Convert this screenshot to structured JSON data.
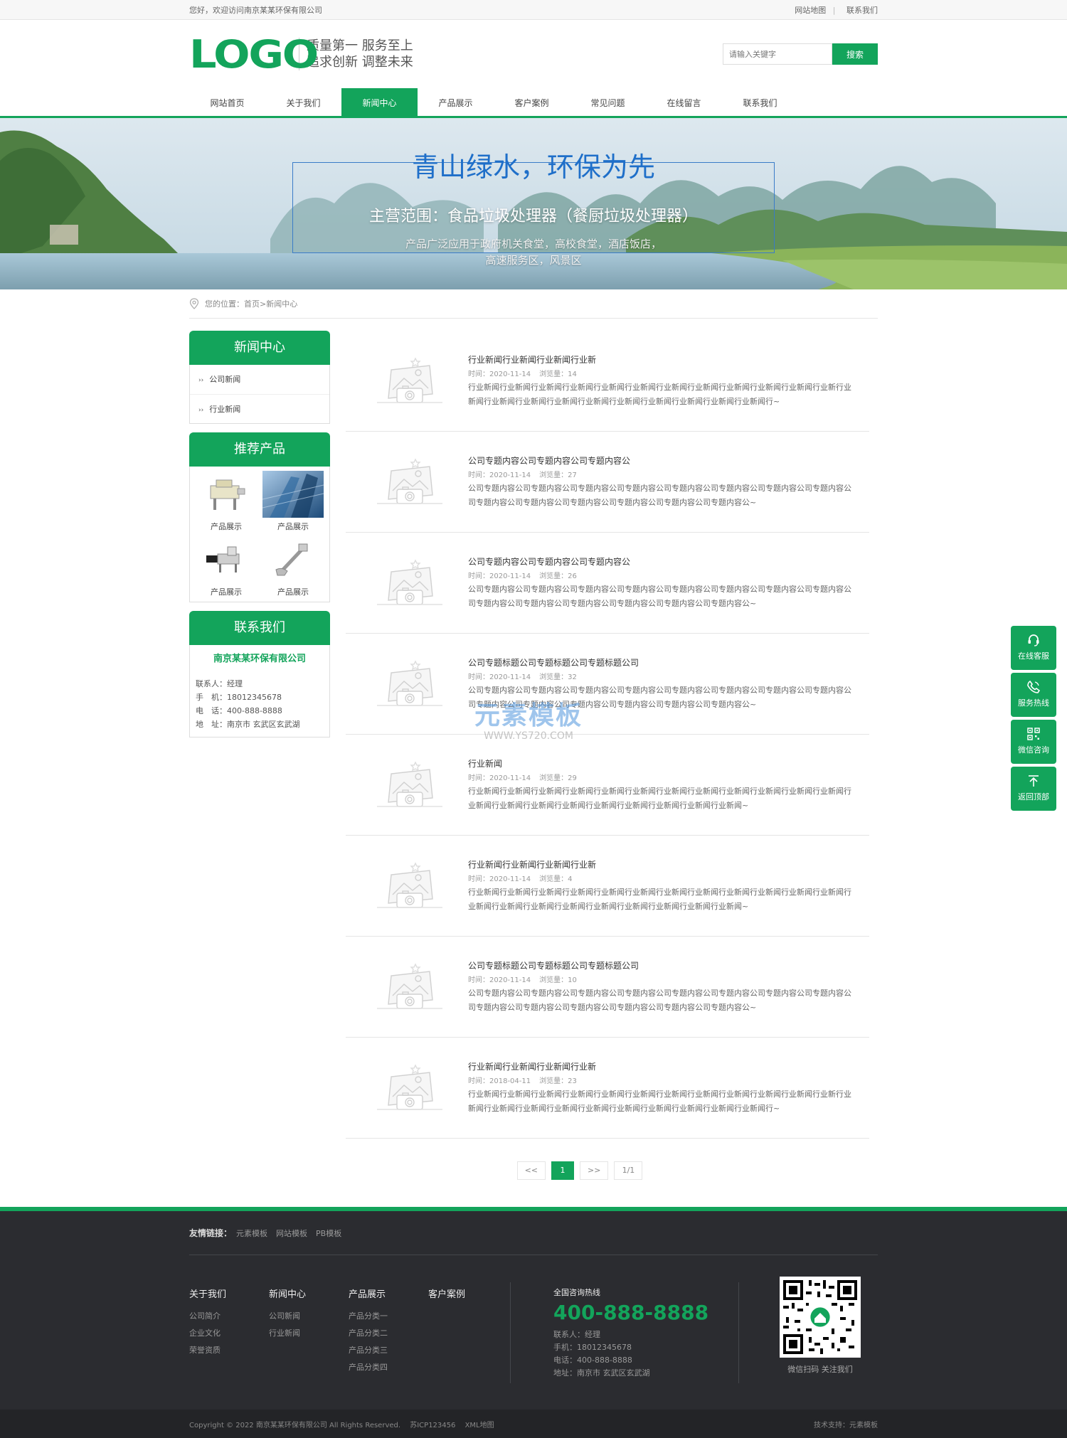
{
  "topbar": {
    "welcome": "您好，欢迎访问南京某某环保有限公司",
    "sitemap": "网站地图",
    "sep": "|",
    "contact": "联系我们"
  },
  "header": {
    "logo": "LOGO",
    "slogan_line1": "质量第一  服务至上",
    "slogan_line2": "追求创新  调整未来",
    "search_placeholder": "请输入关键字",
    "search_button": "搜索"
  },
  "nav": [
    {
      "label": "网站首页"
    },
    {
      "label": "关于我们"
    },
    {
      "label": "新闻中心"
    },
    {
      "label": "产品展示"
    },
    {
      "label": "客户案例"
    },
    {
      "label": "常见问题"
    },
    {
      "label": "在线留言"
    },
    {
      "label": "联系我们"
    }
  ],
  "banner": {
    "title": "青山绿水，环保为先",
    "subtitle": "主营范围：食品垃圾处理器（餐厨垃圾处理器）",
    "desc_line1": "产品广泛应用于政府机关食堂，高校食堂，酒店饭店，",
    "desc_line2": "高速服务区，风景区"
  },
  "breadcrumb": "您的位置：首页>新闻中心",
  "sidebar": {
    "news_title": "新闻中心",
    "categories": [
      {
        "arrow": "››",
        "label": "公司新闻"
      },
      {
        "arrow": "››",
        "label": "行业新闻"
      }
    ],
    "products_title": "推荐产品",
    "products": [
      {
        "label": "产品展示"
      },
      {
        "label": "产品展示"
      },
      {
        "label": "产品展示"
      },
      {
        "label": "产品展示"
      }
    ],
    "contact_title": "联系我们",
    "company": "南京某某环保有限公司",
    "contact_lines": [
      "联系人：经理",
      "手　机：18012345678",
      "电　话：400-888-8888",
      "地　址：南京市 玄武区玄武湖"
    ]
  },
  "news": [
    {
      "title": "行业新闻行业新闻行业新闻行业新",
      "time": "时间：2020-11-14",
      "views": "浏览量：14",
      "desc": "行业新闻行业新闻行业新闻行业新闻行业新闻行业新闻行业新闻行业新闻行业新闻行业新闻行业新闻行业新行业新闻行业新闻行业新闻行业新闻行业新闻行业新闻行业新闻行业新闻行业新闻行业新闻行~"
    },
    {
      "title": "公司专题内容公司专题内容公司专题内容公",
      "time": "时间：2020-11-14",
      "views": "浏览量：27",
      "desc": "公司专题内容公司专题内容公司专题内容公司专题内容公司专题内容公司专题内容公司专题内容公司专题内容公司专题内容公司专题内容公司专题内容公司专题内容公司专题内容公司专题内容公~"
    },
    {
      "title": "公司专题内容公司专题内容公司专题内容公",
      "time": "时间：2020-11-14",
      "views": "浏览量：26",
      "desc": "公司专题内容公司专题内容公司专题内容公司专题内容公司专题内容公司专题内容公司专题内容公司专题内容公司专题内容公司专题内容公司专题内容公司专题内容公司专题内容公司专题内容公~"
    },
    {
      "title": "公司专题标题公司专题标题公司专题标题公司",
      "time": "时间：2020-11-14",
      "views": "浏览量：32",
      "desc": "公司专题内容公司专题内容公司专题内容公司专题内容公司专题内容公司专题内容公司专题内容公司专题内容公司专题内容公司专题内容公司专题内容公司专题内容公司专题内容公司专题内容公~"
    },
    {
      "title": "行业新闻",
      "time": "时间：2020-11-14",
      "views": "浏览量：29",
      "desc": "行业新闻行业新闻行业新闻行业新闻行业新闻行业新闻行业新闻行业新闻行业新闻行业新闻行业新闻行业新闻行业新闻行业新闻行业新闻行业新闻行业新闻行业新闻行业新闻行业新闻行业新闻~"
    },
    {
      "title": "行业新闻行业新闻行业新闻行业新",
      "time": "时间：2020-11-14",
      "views": "浏览量：4",
      "desc": "行业新闻行业新闻行业新闻行业新闻行业新闻行业新闻行业新闻行业新闻行业新闻行业新闻行业新闻行业新闻行业新闻行业新闻行业新闻行业新闻行业新闻行业新闻行业新闻行业新闻行业新闻~"
    },
    {
      "title": "公司专题标题公司专题标题公司专题标题公司",
      "time": "时间：2020-11-14",
      "views": "浏览量：10",
      "desc": "公司专题内容公司专题内容公司专题内容公司专题内容公司专题内容公司专题内容公司专题内容公司专题内容公司专题内容公司专题内容公司专题内容公司专题内容公司专题内容公司专题内容公~"
    },
    {
      "title": "行业新闻行业新闻行业新闻行业新",
      "time": "时间：2018-04-11",
      "views": "浏览量：23",
      "desc": "行业新闻行业新闻行业新闻行业新闻行业新闻行业新闻行业新闻行业新闻行业新闻行业新闻行业新闻行业新行业新闻行业新闻行业新闻行业新闻行业新闻行业新闻行业新闻行业新闻行业新闻行业新闻行~"
    }
  ],
  "pager": {
    "prev": "<<",
    "current": "1",
    "next": ">>",
    "total": "1/1"
  },
  "watermark": {
    "line1": "元素模板",
    "line2": "WWW.YS720.COM"
  },
  "float": [
    {
      "label": "在线客服",
      "icon": "headset-icon"
    },
    {
      "label": "服务热线",
      "icon": "phone-icon"
    },
    {
      "label": "微信咨询",
      "icon": "qrcode-icon"
    },
    {
      "label": "返回顶部",
      "icon": "arrow-up-icon"
    }
  ],
  "footer": {
    "links_label": "友情链接：",
    "links": [
      "元素模板",
      "网站模板",
      "PB模板"
    ],
    "cols": [
      {
        "title": "关于我们",
        "items": [
          "公司简介",
          "企业文化",
          "荣誉资质"
        ]
      },
      {
        "title": "新闻中心",
        "items": [
          "公司新闻",
          "行业新闻"
        ]
      },
      {
        "title": "产品展示",
        "items": [
          "产品分类一",
          "产品分类二",
          "产品分类三",
          "产品分类四"
        ]
      },
      {
        "title": "客户案例",
        "items": []
      }
    ],
    "hotline_label": "全国咨询热线",
    "hotline": "400-888-8888",
    "lines": [
      "联系人：经理",
      "手机：18012345678",
      "电话：400-888-8888",
      "地址：南京市 玄武区玄武湖"
    ],
    "qr_caption": "微信扫码 关注我们",
    "copyright": "Copyright © 2022 南京某某环保有限公司 All Rights Reserved.",
    "icp": "苏ICP123456",
    "xml": "XML地图",
    "support": "技术支持：元素模板"
  },
  "colors": {
    "brand": "#13a45b",
    "footer_bg": "#2b2c30",
    "banner_title": "#1f6fc9"
  }
}
